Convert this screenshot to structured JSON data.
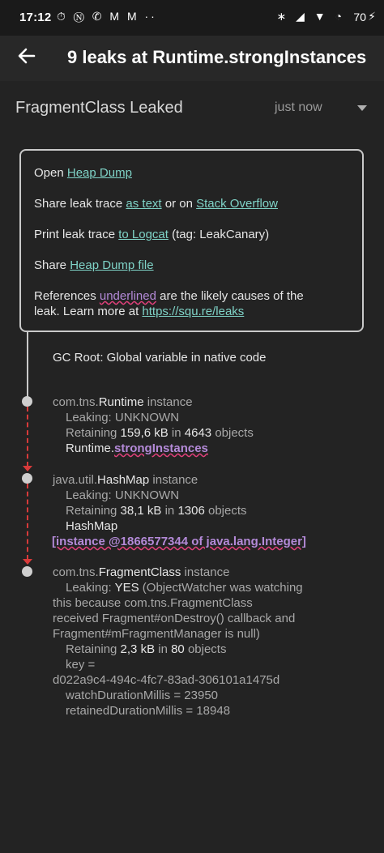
{
  "status_bar": {
    "time": "17:12",
    "left_icons": "⏱ Ⓝ ✆ M M ··",
    "right_icons": "∗ ◢ ▼ ◔",
    "battery": "70",
    "bolt": "⚡"
  },
  "app_bar": {
    "title": "9 leaks at Runtime.strongInstances"
  },
  "header": {
    "title": "FragmentClass Leaked",
    "spinner_value": "just now"
  },
  "info": {
    "open_prefix": "Open ",
    "open_link": "Heap Dump",
    "share_prefix": "Share leak trace ",
    "share_text_link": "as text",
    "share_mid": " or on ",
    "share_so_link": "Stack Overflow",
    "print_prefix": "Print leak trace ",
    "print_link": "to Logcat",
    "print_suffix": " (tag: LeakCanary)",
    "sharefile_prefix": "Share ",
    "sharefile_link": "Heap Dump file",
    "refs_prefix": "References ",
    "refs_underlined": "underlined",
    "refs_suffix": " are the likely causes of the",
    "refs_line2_prefix": "leak. Learn more at ",
    "refs_link": "https://squ.re/leaks"
  },
  "trace": {
    "gc_root": "GC Root: Global variable in native code",
    "node1": {
      "pkg": "com.tns.",
      "cls": "Runtime",
      "suffix": " instance",
      "leaking": "Leaking: UNKNOWN",
      "retaining_prefix": "Retaining ",
      "retaining_size": "159,6 kB",
      "retaining_mid": " in ",
      "retaining_count": "4643",
      "retaining_suffix": " objects",
      "ref_owner": "Runtime.",
      "ref_field": "strongInstances"
    },
    "node2": {
      "pkg": "java.util.",
      "cls": "HashMap",
      "suffix": " instance",
      "leaking": "Leaking: UNKNOWN",
      "retaining_prefix": "Retaining ",
      "retaining_size": "38,1 kB",
      "retaining_mid": " in ",
      "retaining_count": "1306",
      "retaining_suffix": " objects",
      "ref_owner": "HashMap",
      "ref_field": "[instance @1866577344 of java.lang.Integer]"
    },
    "node3": {
      "pkg": "com.tns.",
      "cls": "FragmentClass",
      "suffix": " instance",
      "leaking_label": "Leaking: ",
      "leaking_value": "YES",
      "leaking_reason_1": " (ObjectWatcher was watching",
      "leaking_reason_2": "this because com.tns.FragmentClass",
      "leaking_reason_3": "received Fragment#onDestroy() callback and",
      "leaking_reason_4": "Fragment#mFragmentManager is null)",
      "retaining_prefix": "Retaining ",
      "retaining_size": "2,3 kB",
      "retaining_mid": " in ",
      "retaining_count": "80",
      "retaining_suffix": " objects",
      "key_label": "key =",
      "key_value": "d022a9c4-494c-4fc7-83ad-306101a1475d",
      "watch": "watchDurationMillis = 23950",
      "retained": "retainedDurationMillis = 18948"
    }
  }
}
